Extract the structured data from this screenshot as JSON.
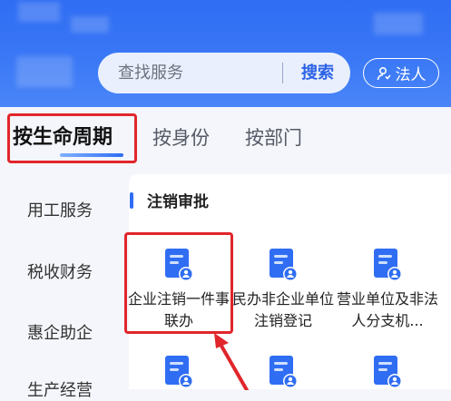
{
  "search": {
    "placeholder": "查找服务",
    "button_label": "搜索"
  },
  "role_button": {
    "label": "法人",
    "icon": "user-icon"
  },
  "tabs": [
    {
      "label": "按生命周期",
      "active": true
    },
    {
      "label": "按身份",
      "active": false
    },
    {
      "label": "按部门",
      "active": false
    }
  ],
  "sidebar": {
    "items": [
      {
        "label": "用工服务"
      },
      {
        "label": "税收财务"
      },
      {
        "label": "惠企助企"
      },
      {
        "label": "生产经营"
      }
    ]
  },
  "section": {
    "title": "注销审批"
  },
  "services": [
    {
      "label": "企业注销一件事联办",
      "icon": "document-user-icon"
    },
    {
      "label": "民办非企业单位注销登记",
      "icon": "document-user-icon"
    },
    {
      "label": "营业单位及非法人分支机...",
      "icon": "document-user-icon"
    },
    {
      "label": "",
      "icon": "document-user-icon"
    },
    {
      "label": "",
      "icon": "document-user-icon"
    },
    {
      "label": "",
      "icon": "document-user-icon"
    }
  ],
  "colors": {
    "brand_blue": "#2f6df3",
    "annotation_red": "#e0262b",
    "background": "#f4f6fb"
  }
}
